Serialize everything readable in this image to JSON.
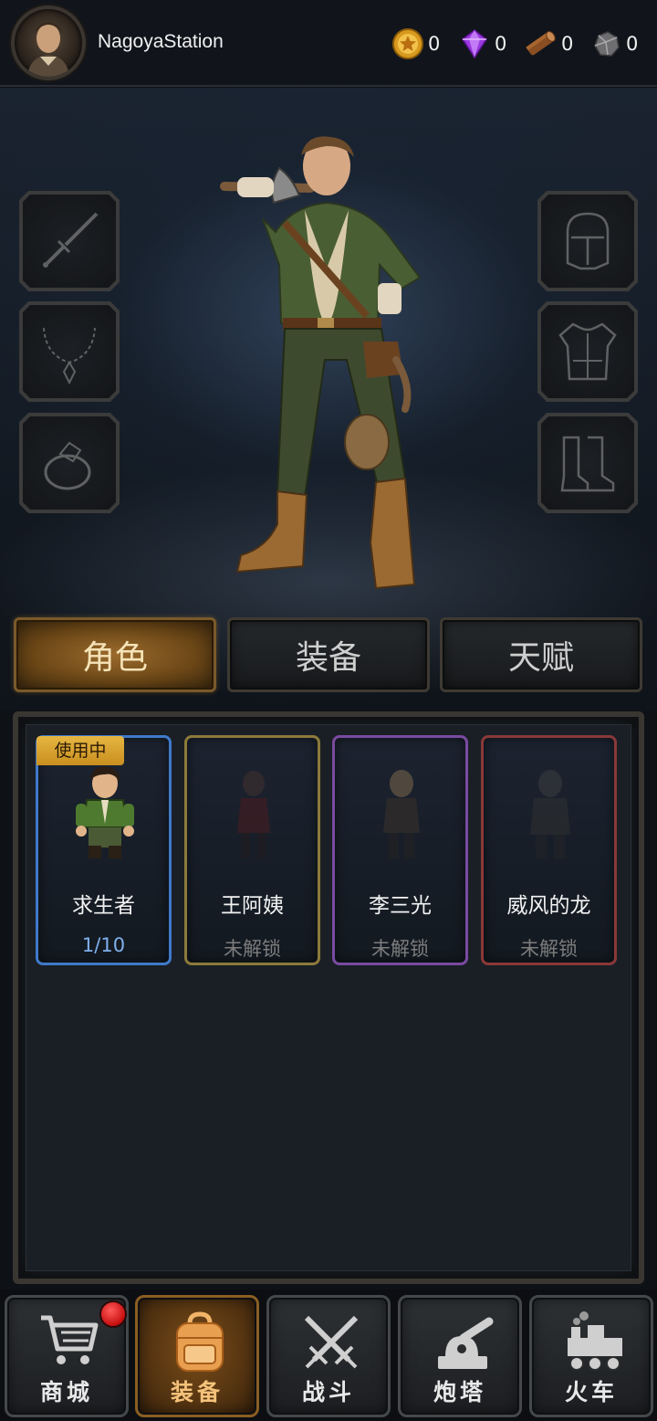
{
  "player": {
    "name": "NagoyaStation"
  },
  "resources": [
    {
      "icon": "gold-coin-icon",
      "value": "0"
    },
    {
      "icon": "purple-gem-icon",
      "value": "0"
    },
    {
      "icon": "wood-log-icon",
      "value": "0"
    },
    {
      "icon": "stone-ore-icon",
      "value": "0"
    }
  ],
  "equipment_slots": {
    "left": [
      "sword-slot-icon",
      "necklace-slot-icon",
      "ring-slot-icon"
    ],
    "right": [
      "helmet-slot-icon",
      "armor-slot-icon",
      "boots-slot-icon"
    ]
  },
  "tabs": [
    {
      "label": "角色",
      "active": true
    },
    {
      "label": "装备",
      "active": false
    },
    {
      "label": "天赋",
      "active": false
    }
  ],
  "characters": [
    {
      "name": "求生者",
      "status": "1/10",
      "in_use_label": "使用中",
      "rarity_color": "#3f79c9"
    },
    {
      "name": "王阿姨",
      "status": "未解锁",
      "rarity_color": "#8c7a3c"
    },
    {
      "name": "李三光",
      "status": "未解锁",
      "rarity_color": "#7a4aa0"
    },
    {
      "name": "威风的龙",
      "status": "未解锁",
      "rarity_color": "#8a3838"
    }
  ],
  "nav": [
    {
      "label": "商城",
      "icon": "cart-icon",
      "active": false,
      "has_badge": true
    },
    {
      "label": "装备",
      "icon": "backpack-icon",
      "active": true
    },
    {
      "label": "战斗",
      "icon": "crossed-swords-icon",
      "active": false
    },
    {
      "label": "炮塔",
      "icon": "turret-icon",
      "active": false
    },
    {
      "label": "火车",
      "icon": "train-icon",
      "active": false
    }
  ]
}
